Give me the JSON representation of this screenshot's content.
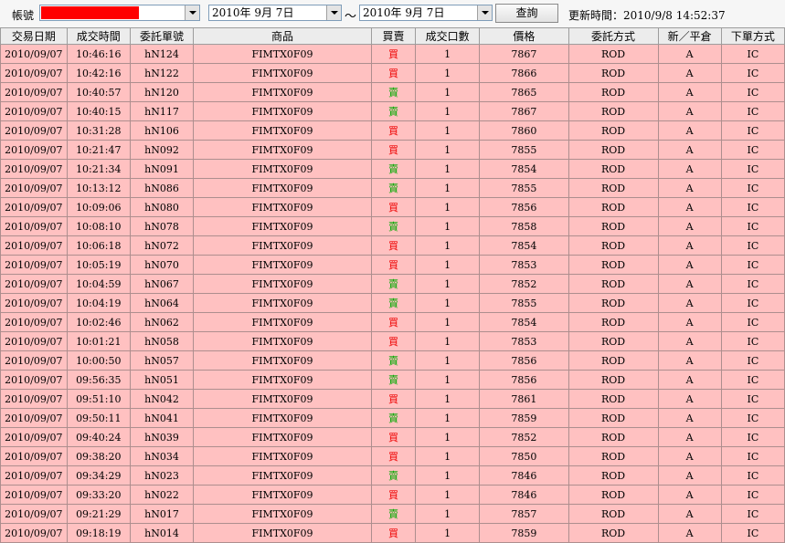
{
  "toolbar": {
    "account_label": "帳號",
    "account_value": "",
    "date_from": "2010年  9月  7日",
    "date_separator": "～",
    "date_to": "2010年  9月  7日",
    "query_label": "查詢",
    "updated_label": "更新時間：",
    "updated_value": "2010/9/8 14:52:37"
  },
  "colors": {
    "row_bg": "#ffc1c1",
    "buy": "#ee0000",
    "sell": "#00aa00",
    "account_mask": "#ff0000"
  },
  "table": {
    "columns": [
      "交易日期",
      "成交時間",
      "委託單號",
      "商品",
      "買賣",
      "成交口數",
      "價格",
      "委託方式",
      "新／平倉",
      "下單方式"
    ],
    "rows": [
      [
        "2010/09/07",
        "10:46:16",
        "hN124",
        "FIMTX0F09",
        "買",
        "1",
        "7867",
        "ROD",
        "A",
        "IC"
      ],
      [
        "2010/09/07",
        "10:42:16",
        "hN122",
        "FIMTX0F09",
        "買",
        "1",
        "7866",
        "ROD",
        "A",
        "IC"
      ],
      [
        "2010/09/07",
        "10:40:57",
        "hN120",
        "FIMTX0F09",
        "賣",
        "1",
        "7865",
        "ROD",
        "A",
        "IC"
      ],
      [
        "2010/09/07",
        "10:40:15",
        "hN117",
        "FIMTX0F09",
        "賣",
        "1",
        "7867",
        "ROD",
        "A",
        "IC"
      ],
      [
        "2010/09/07",
        "10:31:28",
        "hN106",
        "FIMTX0F09",
        "買",
        "1",
        "7860",
        "ROD",
        "A",
        "IC"
      ],
      [
        "2010/09/07",
        "10:21:47",
        "hN092",
        "FIMTX0F09",
        "買",
        "1",
        "7855",
        "ROD",
        "A",
        "IC"
      ],
      [
        "2010/09/07",
        "10:21:34",
        "hN091",
        "FIMTX0F09",
        "賣",
        "1",
        "7854",
        "ROD",
        "A",
        "IC"
      ],
      [
        "2010/09/07",
        "10:13:12",
        "hN086",
        "FIMTX0F09",
        "賣",
        "1",
        "7855",
        "ROD",
        "A",
        "IC"
      ],
      [
        "2010/09/07",
        "10:09:06",
        "hN080",
        "FIMTX0F09",
        "買",
        "1",
        "7856",
        "ROD",
        "A",
        "IC"
      ],
      [
        "2010/09/07",
        "10:08:10",
        "hN078",
        "FIMTX0F09",
        "賣",
        "1",
        "7858",
        "ROD",
        "A",
        "IC"
      ],
      [
        "2010/09/07",
        "10:06:18",
        "hN072",
        "FIMTX0F09",
        "買",
        "1",
        "7854",
        "ROD",
        "A",
        "IC"
      ],
      [
        "2010/09/07",
        "10:05:19",
        "hN070",
        "FIMTX0F09",
        "買",
        "1",
        "7853",
        "ROD",
        "A",
        "IC"
      ],
      [
        "2010/09/07",
        "10:04:59",
        "hN067",
        "FIMTX0F09",
        "賣",
        "1",
        "7852",
        "ROD",
        "A",
        "IC"
      ],
      [
        "2010/09/07",
        "10:04:19",
        "hN064",
        "FIMTX0F09",
        "賣",
        "1",
        "7855",
        "ROD",
        "A",
        "IC"
      ],
      [
        "2010/09/07",
        "10:02:46",
        "hN062",
        "FIMTX0F09",
        "買",
        "1",
        "7854",
        "ROD",
        "A",
        "IC"
      ],
      [
        "2010/09/07",
        "10:01:21",
        "hN058",
        "FIMTX0F09",
        "買",
        "1",
        "7853",
        "ROD",
        "A",
        "IC"
      ],
      [
        "2010/09/07",
        "10:00:50",
        "hN057",
        "FIMTX0F09",
        "賣",
        "1",
        "7856",
        "ROD",
        "A",
        "IC"
      ],
      [
        "2010/09/07",
        "09:56:35",
        "hN051",
        "FIMTX0F09",
        "賣",
        "1",
        "7856",
        "ROD",
        "A",
        "IC"
      ],
      [
        "2010/09/07",
        "09:51:10",
        "hN042",
        "FIMTX0F09",
        "買",
        "1",
        "7861",
        "ROD",
        "A",
        "IC"
      ],
      [
        "2010/09/07",
        "09:50:11",
        "hN041",
        "FIMTX0F09",
        "賣",
        "1",
        "7859",
        "ROD",
        "A",
        "IC"
      ],
      [
        "2010/09/07",
        "09:40:24",
        "hN039",
        "FIMTX0F09",
        "買",
        "1",
        "7852",
        "ROD",
        "A",
        "IC"
      ],
      [
        "2010/09/07",
        "09:38:20",
        "hN034",
        "FIMTX0F09",
        "買",
        "1",
        "7850",
        "ROD",
        "A",
        "IC"
      ],
      [
        "2010/09/07",
        "09:34:29",
        "hN023",
        "FIMTX0F09",
        "賣",
        "1",
        "7846",
        "ROD",
        "A",
        "IC"
      ],
      [
        "2010/09/07",
        "09:33:20",
        "hN022",
        "FIMTX0F09",
        "買",
        "1",
        "7846",
        "ROD",
        "A",
        "IC"
      ],
      [
        "2010/09/07",
        "09:21:29",
        "hN017",
        "FIMTX0F09",
        "賣",
        "1",
        "7857",
        "ROD",
        "A",
        "IC"
      ],
      [
        "2010/09/07",
        "09:18:19",
        "hN014",
        "FIMTX0F09",
        "買",
        "1",
        "7859",
        "ROD",
        "A",
        "IC"
      ]
    ]
  }
}
